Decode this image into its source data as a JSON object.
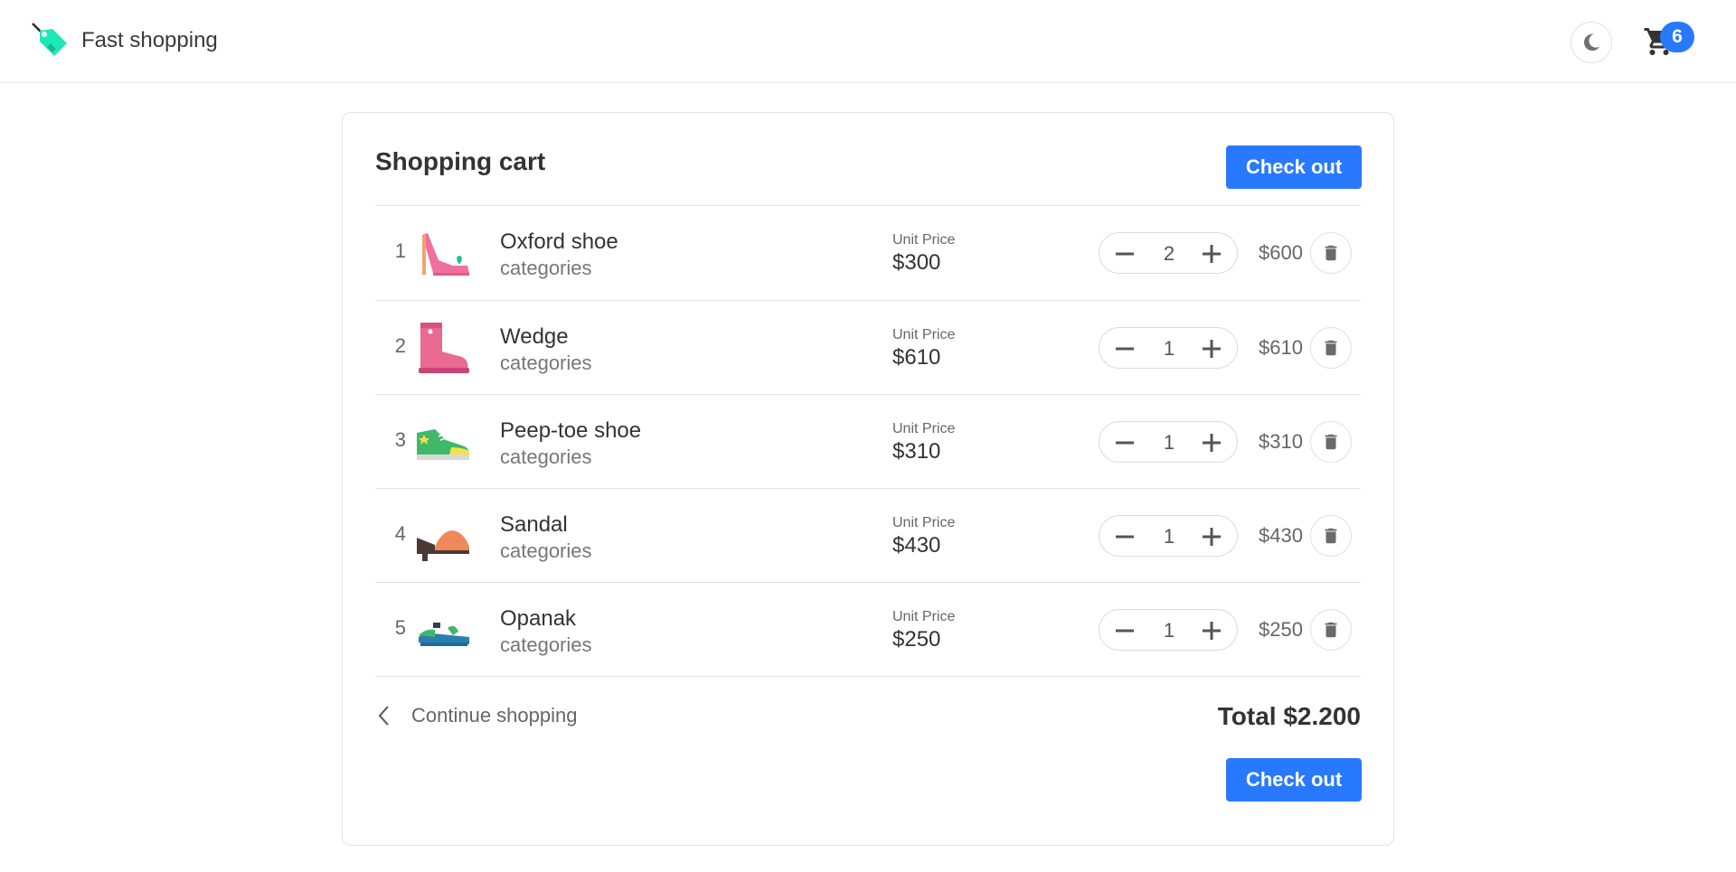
{
  "header": {
    "brand_name": "Fast shopping",
    "cart_count": "6",
    "accent_color": "#2979ff",
    "brand_color": "#1de9b6"
  },
  "cart": {
    "title": "Shopping cart",
    "checkout_label": "Check out",
    "unit_price_label": "Unit Price",
    "items": [
      {
        "index": "1",
        "name": "Oxford shoe",
        "category": "categories",
        "unit_price": "$300",
        "quantity": "2",
        "line_total": "$600",
        "image": "pink-heel-icon"
      },
      {
        "index": "2",
        "name": "Wedge",
        "category": "categories",
        "unit_price": "$610",
        "quantity": "1",
        "line_total": "$610",
        "image": "pink-boot-icon"
      },
      {
        "index": "3",
        "name": "Peep-toe shoe",
        "category": "categories",
        "unit_price": "$310",
        "quantity": "1",
        "line_total": "$310",
        "image": "green-sneaker-icon"
      },
      {
        "index": "4",
        "name": "Sandal",
        "category": "categories",
        "unit_price": "$430",
        "quantity": "1",
        "line_total": "$430",
        "image": "orange-sandal-icon"
      },
      {
        "index": "5",
        "name": "Opanak",
        "category": "categories",
        "unit_price": "$250",
        "quantity": "1",
        "line_total": "$250",
        "image": "green-flat-sandal-icon"
      }
    ],
    "continue_label": "Continue shopping",
    "total_label": "Total $2.200"
  }
}
